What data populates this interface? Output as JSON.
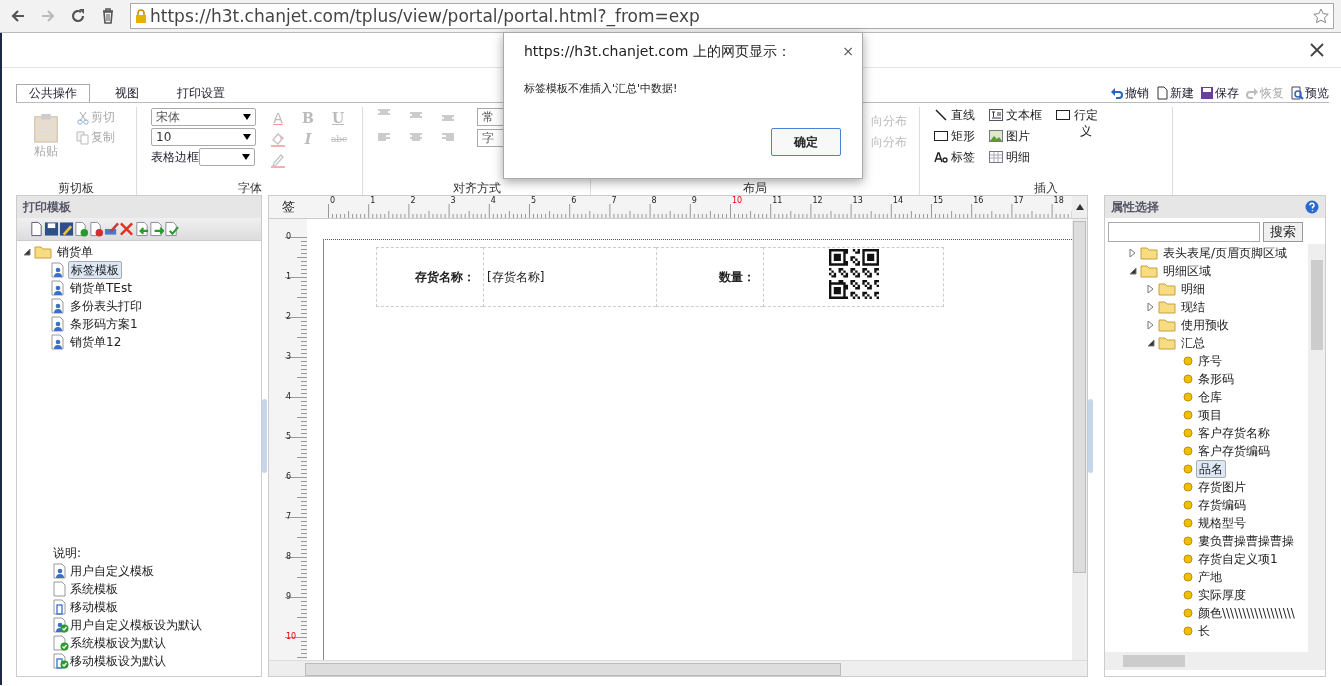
{
  "browser": {
    "url": "https://h3t.chanjet.com/tplus/view/portal/portal.html?_from=exp"
  },
  "ribbon": {
    "tabs": [
      {
        "label": "公共操作",
        "selected": true
      },
      {
        "label": "视图",
        "selected": false
      },
      {
        "label": "打印设置",
        "selected": false
      }
    ],
    "quick_actions": [
      {
        "kind": "undo",
        "label": "撤销",
        "disabled": false
      },
      {
        "kind": "new",
        "label": "新建",
        "disabled": false
      },
      {
        "kind": "save",
        "label": "保存",
        "disabled": false
      },
      {
        "kind": "redo",
        "label": "恢复",
        "disabled": true
      },
      {
        "kind": "preview",
        "label": "预览",
        "disabled": false
      }
    ],
    "clipboard": {
      "title": "剪切板",
      "paste": {
        "label": "粘贴",
        "disabled": true
      },
      "items": [
        {
          "kind": "cut",
          "label": "剪切",
          "disabled": true
        },
        {
          "kind": "copy",
          "label": "复制",
          "disabled": true
        }
      ]
    },
    "font": {
      "title": "字体",
      "font_name": "宋体",
      "font_size": "10",
      "border_label": "表格边框",
      "format": [
        {
          "kind": "color",
          "label": "A",
          "disabled": true
        },
        {
          "kind": "bold",
          "label": "B",
          "disabled": true
        },
        {
          "kind": "underline",
          "label": "U",
          "disabled": true
        },
        {
          "kind": "fill",
          "disabled": true
        },
        {
          "kind": "italic",
          "label": "I",
          "disabled": true
        },
        {
          "kind": "strike",
          "label": "abc",
          "disabled": true
        },
        {
          "kind": "pen",
          "disabled": true
        }
      ]
    },
    "align": {
      "title": "对齐方式",
      "fields": [
        "常",
        "字"
      ]
    },
    "layout": {
      "title": "布局",
      "items": [
        {
          "label": "向分布",
          "disabled": true
        },
        {
          "label": "向分布",
          "disabled": true
        }
      ]
    },
    "insert": {
      "title": "插入",
      "items": [
        {
          "kind": "line",
          "label": "直线"
        },
        {
          "kind": "rect",
          "label": "矩形"
        },
        {
          "kind": "label",
          "label": "标签"
        },
        {
          "kind": "textbox",
          "label": "文本框"
        },
        {
          "kind": "image",
          "label": "图片"
        },
        {
          "kind": "detail",
          "label": "明细"
        },
        {
          "kind": "rowdef",
          "label": "行定义"
        }
      ]
    }
  },
  "dialog": {
    "title": "https://h3t.chanjet.com 上的网页显示：",
    "close": "×",
    "message": "标签模板不准插入'汇总'中数据!",
    "button": "确定"
  },
  "templates": {
    "title": "打印模板",
    "tree": [
      {
        "kind": "folder",
        "label": "销货单",
        "expanded": true,
        "children": [
          {
            "kind": "template",
            "label": "标签模板",
            "selected": true
          },
          {
            "kind": "template",
            "label": "销货单TEst",
            "selected": false
          },
          {
            "kind": "template",
            "label": "多份表头打印",
            "selected": false
          },
          {
            "kind": "template",
            "label": "条形码方案1",
            "selected": false
          },
          {
            "kind": "template",
            "label": "销货单12",
            "selected": false
          }
        ]
      }
    ],
    "legend": {
      "title": "说明:",
      "items": [
        {
          "kind": "user",
          "default": false,
          "label": "用户自定义模板"
        },
        {
          "kind": "system",
          "default": false,
          "label": "系统模板"
        },
        {
          "kind": "mobile",
          "default": false,
          "label": "移动模板"
        },
        {
          "kind": "user",
          "default": true,
          "label": "用户自定义模板设为默认"
        },
        {
          "kind": "system",
          "default": true,
          "label": "系统模板设为默认"
        },
        {
          "kind": "mobile",
          "default": true,
          "label": "移动模板设为默认"
        }
      ]
    }
  },
  "designer": {
    "corner": "签",
    "h_ruler": [
      {
        "label": "0",
        "highlight": false
      },
      {
        "label": "1",
        "highlight": false
      },
      {
        "label": "2",
        "highlight": false
      },
      {
        "label": "3",
        "highlight": false
      },
      {
        "label": "4",
        "highlight": false
      },
      {
        "label": "5",
        "highlight": false
      },
      {
        "label": "6",
        "highlight": false
      },
      {
        "label": "7",
        "highlight": false
      },
      {
        "label": "8",
        "highlight": false
      },
      {
        "label": "9",
        "highlight": false
      },
      {
        "label": "10",
        "highlight": true
      },
      {
        "label": "11",
        "highlight": false
      },
      {
        "label": "12",
        "highlight": false
      },
      {
        "label": "13",
        "highlight": false
      },
      {
        "label": "14",
        "highlight": false
      },
      {
        "label": "15",
        "highlight": false
      },
      {
        "label": "16",
        "highlight": false
      },
      {
        "label": "17",
        "highlight": false
      },
      {
        "label": "18",
        "highlight": false
      }
    ],
    "v_ruler": [
      {
        "label": "0",
        "highlight": false
      },
      {
        "label": "1",
        "highlight": false
      },
      {
        "label": "2",
        "highlight": false
      },
      {
        "label": "3",
        "highlight": false
      },
      {
        "label": "4",
        "highlight": false
      },
      {
        "label": "5",
        "highlight": false
      },
      {
        "label": "6",
        "highlight": false
      },
      {
        "label": "7",
        "highlight": false
      },
      {
        "label": "8",
        "highlight": false
      },
      {
        "label": "9",
        "highlight": false
      },
      {
        "label": "10",
        "highlight": true
      }
    ],
    "cells": [
      {
        "kind": "caption",
        "text": "存货名称："
      },
      {
        "kind": "field",
        "text": "[存货名称]"
      },
      {
        "kind": "caption",
        "text": "数量："
      },
      {
        "kind": "qr"
      }
    ]
  },
  "attributes": {
    "title": "属性选择",
    "search_button": "搜索",
    "tree": [
      {
        "kind": "folder",
        "label": "表头表尾/页眉页脚区域",
        "expanded": false
      },
      {
        "kind": "folder",
        "label": "明细区域",
        "expanded": true,
        "children": [
          {
            "kind": "folder",
            "label": "明细",
            "expanded": false
          },
          {
            "kind": "folder",
            "label": "现结",
            "expanded": false
          },
          {
            "kind": "folder",
            "label": "使用预收",
            "expanded": false
          },
          {
            "kind": "folder",
            "label": "汇总",
            "expanded": true,
            "children": [
              {
                "kind": "field",
                "label": "序号",
                "selected": false
              },
              {
                "kind": "field",
                "label": "条形码",
                "selected": false
              },
              {
                "kind": "field",
                "label": "仓库",
                "selected": false
              },
              {
                "kind": "field",
                "label": "项目",
                "selected": false
              },
              {
                "kind": "field",
                "label": "客户存货名称",
                "selected": false
              },
              {
                "kind": "field",
                "label": "客户存货编码",
                "selected": false
              },
              {
                "kind": "field",
                "label": "品名",
                "selected": true
              },
              {
                "kind": "field",
                "label": "存货图片",
                "selected": false
              },
              {
                "kind": "field",
                "label": "存货编码",
                "selected": false
              },
              {
                "kind": "field",
                "label": "规格型号",
                "selected": false
              },
              {
                "kind": "field",
                "label": "婁负曹操曹操曹操",
                "selected": false
              },
              {
                "kind": "field",
                "label": "存货自定义项1",
                "selected": false
              },
              {
                "kind": "field",
                "label": "产地",
                "selected": false
              },
              {
                "kind": "field",
                "label": "实际厚度",
                "selected": false
              },
              {
                "kind": "field",
                "label": "颜色\\\\\\\\\\\\\\\\\\\\\\\\\\\\\\\\\\\\",
                "selected": false
              },
              {
                "kind": "field",
                "label": "长",
                "selected": false
              }
            ]
          }
        ]
      }
    ]
  }
}
